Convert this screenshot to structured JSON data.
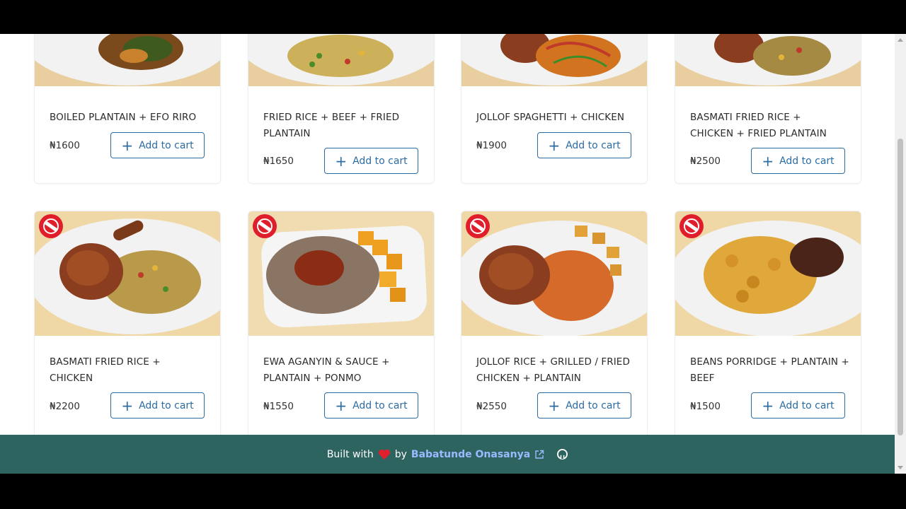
{
  "currency": "₦",
  "cards": [
    {
      "name": "BOILED PLANTAIN + EFO RIRO",
      "price": "₦1600",
      "button": "Add to cart"
    },
    {
      "name": "FRIED RICE + BEEF + FRIED PLANTAIN",
      "price": "₦1650",
      "button": "Add to cart"
    },
    {
      "name": "JOLLOF SPAGHETTI + CHICKEN",
      "price": "₦1900",
      "button": "Add to cart"
    },
    {
      "name": "BASMATI FRIED RICE + CHICKEN + FRIED PLANTAIN",
      "price": "₦2500",
      "button": "Add to cart"
    },
    {
      "name": "BASMATI FRIED RICE + CHICKEN",
      "price": "₦2200",
      "button": "Add to cart"
    },
    {
      "name": "EWA AGANYIN & SAUCE + PLANTAIN + PONMO",
      "price": "₦1550",
      "button": "Add to cart"
    },
    {
      "name": "JOLLOF RICE + GRILLED / FRIED CHICKEN + PLANTAIN",
      "price": "₦2550",
      "button": "Add to cart"
    },
    {
      "name": "BEANS PORRIDGE + PLANTAIN + BEEF",
      "price": "₦1500",
      "button": "Add to cart"
    }
  ],
  "footer": {
    "built_with": "Built with",
    "by": "by",
    "author": "Babatunde Onasanya",
    "icons": [
      "heart-icon",
      "external-link-icon",
      "github-icon"
    ]
  },
  "colors": {
    "accent": "#2b6ca3",
    "footer_bg": "#2e6460",
    "badge": "#e01d2a",
    "author_link": "#9bb9ff"
  }
}
